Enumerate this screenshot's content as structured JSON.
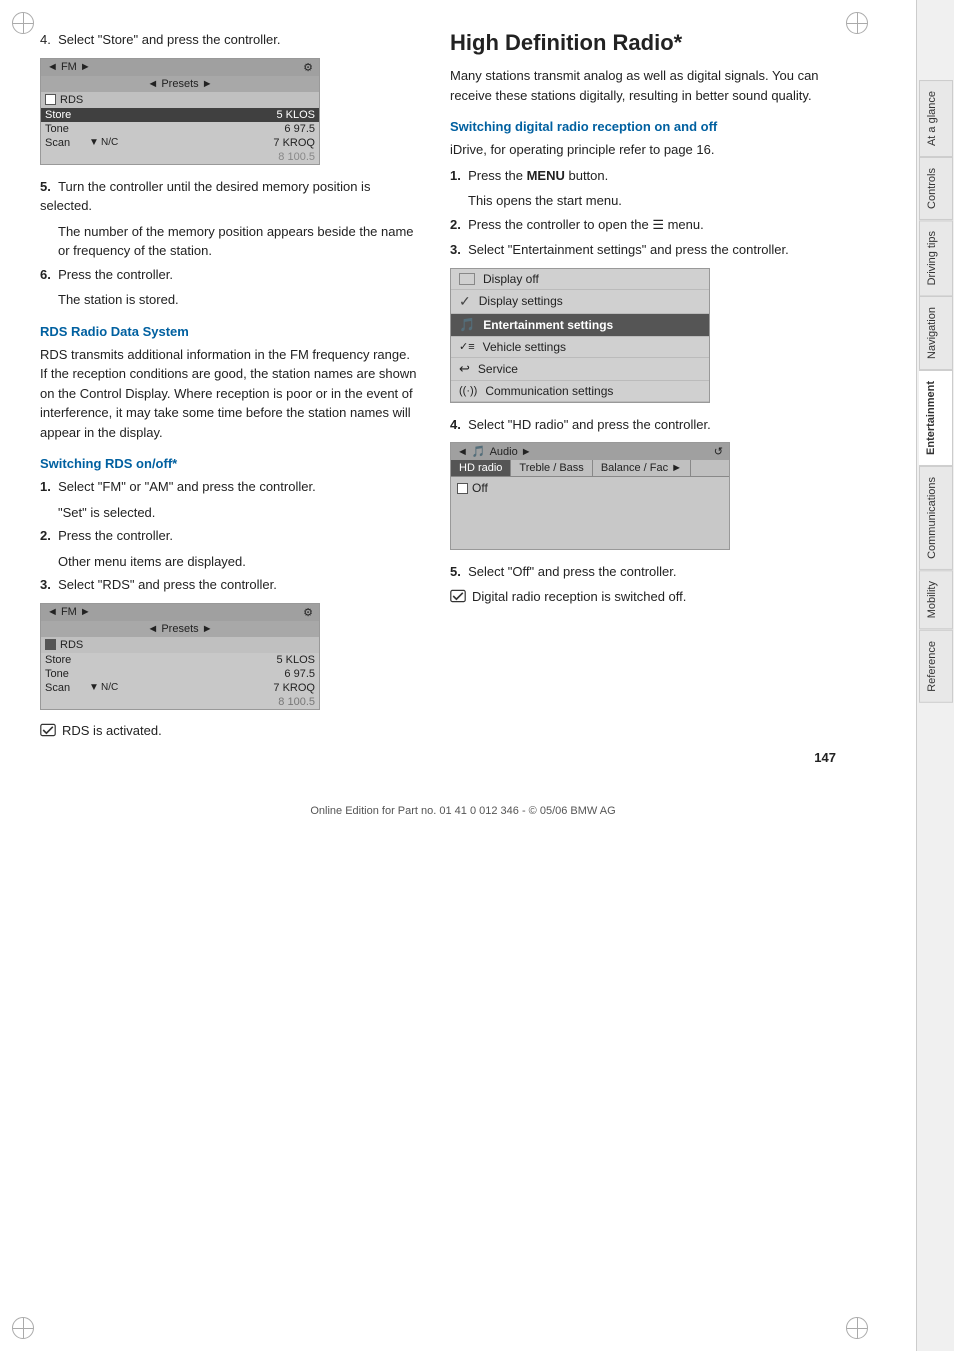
{
  "page": {
    "number": "147",
    "footer": "Online Edition for Part no. 01 41 0 012 346 - © 05/06 BMW AG"
  },
  "sidebar": {
    "tabs": [
      {
        "label": "At a glance",
        "active": false
      },
      {
        "label": "Controls",
        "active": false
      },
      {
        "label": "Driving tips",
        "active": false
      },
      {
        "label": "Navigation",
        "active": false
      },
      {
        "label": "Entertainment",
        "active": true
      },
      {
        "label": "Communications",
        "active": false
      },
      {
        "label": "Mobility",
        "active": false
      },
      {
        "label": "Reference",
        "active": false
      }
    ]
  },
  "left_col": {
    "step4_text": "4.  Select \"Store\" and press the controller.",
    "step5_text": "5.  Turn the controller until the desired memory position is selected.",
    "step5_note": "The number of the memory position appears beside the name or frequency of the station.",
    "step6_text": "6.  Press the controller.",
    "step6_note": "The station is stored.",
    "rds_title": "RDS Radio Data System",
    "rds_body": "RDS transmits additional information in the FM frequency range. If the reception conditions are good, the station names are shown on the Control Display. Where reception is poor or in the event of interference, it may take some time before the station names will appear in the display.",
    "rds_switch_title": "Switching RDS on/off*",
    "rds_step1": "1.  Select \"FM\" or \"AM\" and press the controller.",
    "rds_step1_note": "\"Set\" is selected.",
    "rds_step2": "2.  Press the controller.",
    "rds_step2_note": "Other menu items are displayed.",
    "rds_step3": "3.  Select \"RDS\" and press the controller.",
    "rds_activated": "RDS is activated.",
    "fm_screen1": {
      "header_left": "◄ FM ►",
      "header_right": "⚙",
      "presets": "◄ Presets ►",
      "rows": [
        {
          "label": "RDS",
          "station": "",
          "checkbox": true
        },
        {
          "label": "Store",
          "station": "5 KLOS",
          "selected": false
        },
        {
          "label": "Tone",
          "station": "6 97.5",
          "selected": false
        },
        {
          "label": "Scan",
          "station": "7 KROQ",
          "arrow": "▼",
          "selected": false
        },
        {
          "label": "",
          "station": "8 100.5",
          "selected": false
        }
      ]
    },
    "fm_screen2": {
      "header_left": "◄ FM ►",
      "header_right": "⚙",
      "presets": "◄ Presets ►",
      "rows": [
        {
          "label": "RDS",
          "station": "",
          "checkbox": true
        },
        {
          "label": "Store",
          "station": "5 KLOS",
          "selected": false
        },
        {
          "label": "Tone",
          "station": "6 97.5",
          "selected": false
        },
        {
          "label": "Scan",
          "station": "7 KROQ",
          "arrow": "▼",
          "selected": false
        },
        {
          "label": "",
          "station": "8 100.5",
          "selected": false
        }
      ]
    }
  },
  "right_col": {
    "main_title": "High Definition Radio*",
    "intro": "Many stations transmit analog as well as digital signals. You can receive these stations digitally, resulting in better sound quality.",
    "switch_title": "Switching digital radio reception on and off",
    "idrive_note": "iDrive, for operating principle refer to page 16.",
    "step1": "1.  Press the MENU button.",
    "step1_note": "This opens the start menu.",
    "step2": "2.  Press the controller to open the ☰ menu.",
    "step3": "3.  Select \"Entertainment settings\" and press the controller.",
    "menu_items": [
      {
        "label": "Display off",
        "icon": "display",
        "highlighted": false
      },
      {
        "label": "Display settings",
        "icon": "checkmark",
        "highlighted": false
      },
      {
        "label": "Entertainment settings",
        "icon": "music",
        "highlighted": true
      },
      {
        "label": "Vehicle settings",
        "icon": "check-vehicle",
        "highlighted": false
      },
      {
        "label": "Service",
        "icon": "arrow",
        "highlighted": false
      },
      {
        "label": "Communication settings",
        "icon": "waves",
        "highlighted": false
      }
    ],
    "step4": "4.  Select \"HD radio\" and press the controller.",
    "hd_screen": {
      "header_left": "◄ Audio ►",
      "header_right": "↺",
      "tabs": [
        "HD radio",
        "Treble / Bass",
        "Balance / Fac ►"
      ],
      "off_row": "Off"
    },
    "step5": "5.  Select \"Off\" and press the controller.",
    "step5_note": "Digital radio reception is switched off."
  }
}
